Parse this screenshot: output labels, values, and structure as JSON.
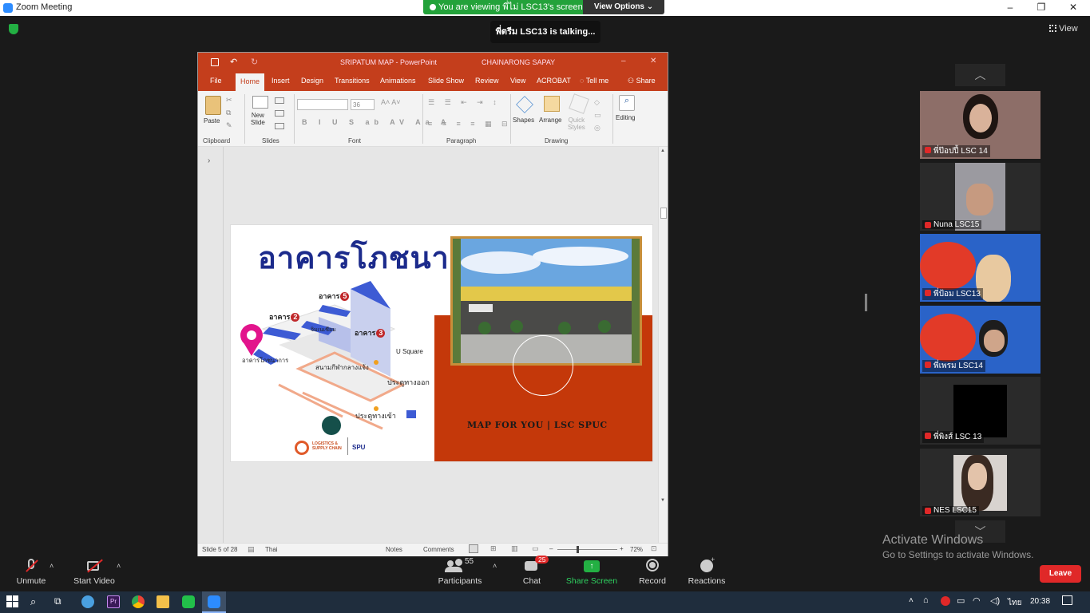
{
  "window": {
    "title": "Zoom Meeting",
    "minimize": "–",
    "maximize": "❐",
    "close": "✕"
  },
  "share_banner": {
    "text": "You are viewing พี่ไม่ LSC13's screen",
    "view_options": "View Options ⌄"
  },
  "talking": "พี่ตรีม LSC13  is  talking...",
  "view_button": "View",
  "powerpoint": {
    "title": "SRIPATUM MAP  -  PowerPoint",
    "user": "CHAINARONG SAPAY",
    "tabs": [
      "File",
      "Home",
      "Insert",
      "Design",
      "Transitions",
      "Animations",
      "Slide Show",
      "Review",
      "View",
      "ACROBAT"
    ],
    "tell_me": "Tell me",
    "share": "Share",
    "ribbon": {
      "paste": "Paste",
      "new_slide": "New\nSlide",
      "font_size": "36",
      "shapes": "Shapes",
      "arrange": "Arrange",
      "quick_styles": "Quick\nStyles",
      "editing": "Editing",
      "groups": [
        "Clipboard",
        "Slides",
        "Font",
        "Paragraph",
        "Drawing"
      ]
    },
    "slide": {
      "title": "อาคารโภชนา",
      "labels": {
        "building5": "อาคาร",
        "building5_num": "5",
        "building2": "อาคาร",
        "building2_num": "2",
        "building3": "อาคาร",
        "building3_num": "3",
        "gym": "จิมเนเซียม",
        "canteen": "อาคารโภชนาการ",
        "usquare": "U Square",
        "stadium": "สนามกีฬากลางแจ้ง",
        "exit_gate": "ประตูทางออก",
        "entry_gate": "ประตูทางเข้า",
        "logo_text": "LOGISTICS &\nSUPPLY CHAIN",
        "spu": "SPU"
      },
      "caption": "MAP FOR YOU | LSC SPUC"
    },
    "status": {
      "slide": "Slide 5 of 28",
      "language": "Thai",
      "notes": "Notes",
      "comments": "Comments",
      "zoom": "72%"
    }
  },
  "participants_tiles": [
    {
      "name": "พี่ป๊อปปี้ LSC 14"
    },
    {
      "name": "Nuna LSC15"
    },
    {
      "name": "พี่ป้อม LSC13"
    },
    {
      "name": "พี่เพรม LSC14"
    },
    {
      "name": "พี่พิงส์ LSC 13"
    },
    {
      "name": "NES LSC15"
    }
  ],
  "toolbar": {
    "unmute": "Unmute",
    "start_video": "Start Video",
    "participants": "Participants",
    "participants_count": "55",
    "chat": "Chat",
    "chat_badge": "25",
    "share_screen": "Share Screen",
    "record": "Record",
    "reactions": "Reactions",
    "leave": "Leave"
  },
  "activate_windows": {
    "title": "Activate Windows",
    "subtitle": "Go to Settings to activate Windows."
  },
  "taskbar": {
    "language": "ไทย",
    "time": "20:38"
  },
  "colors": {
    "ppt_red": "#c43e1c",
    "zoom_green": "#23a23a",
    "leave_red": "#e02828",
    "slide_blue": "#1c2b8c"
  }
}
